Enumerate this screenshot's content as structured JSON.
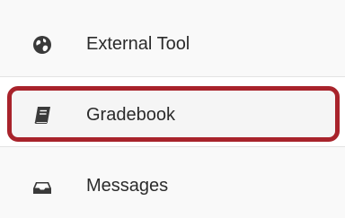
{
  "menu": {
    "items": [
      {
        "label": "External Tool",
        "icon": "globe-icon"
      },
      {
        "label": "Gradebook",
        "icon": "book-icon",
        "highlighted": true
      },
      {
        "label": "Messages",
        "icon": "inbox-icon"
      }
    ]
  },
  "colors": {
    "highlight_border": "#a8232b",
    "icon": "#3a3a3a",
    "text": "#2b2b2b"
  }
}
